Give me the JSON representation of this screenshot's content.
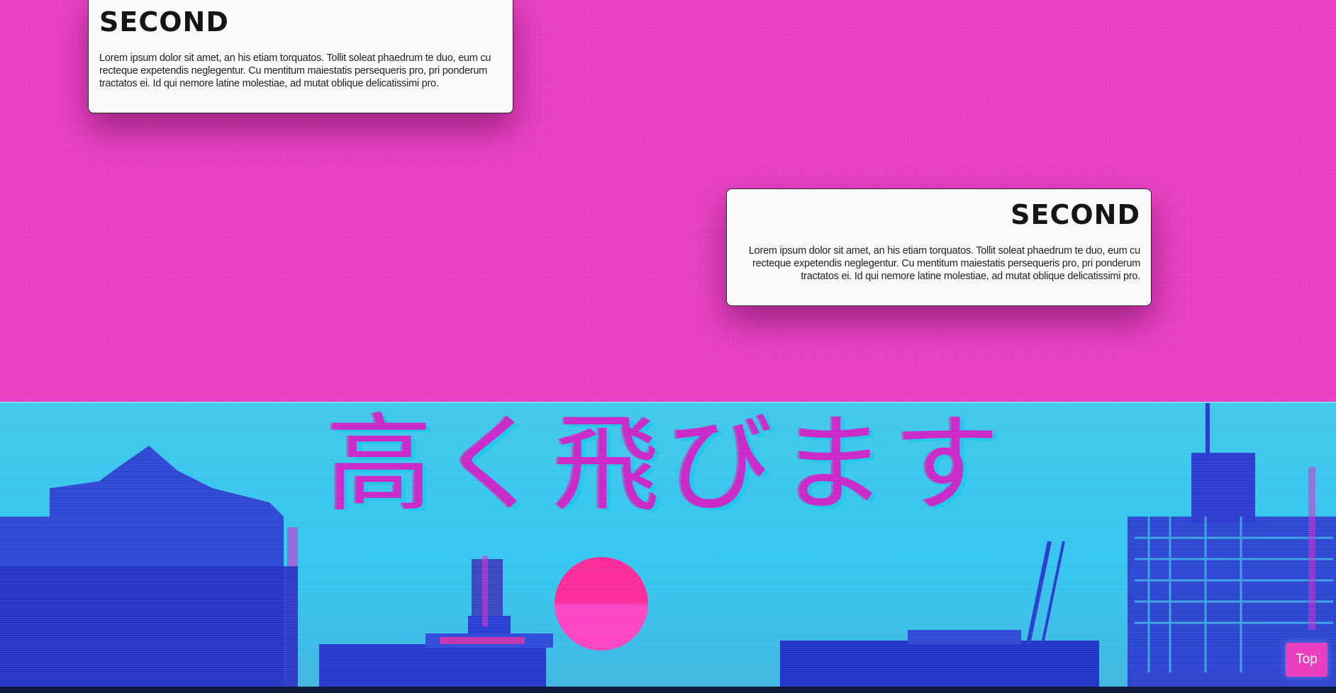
{
  "cards": [
    {
      "title": "SECOND",
      "text": "Lorem ipsum dolor sit amet, an his etiam torquatos. Tollit soleat phaedrum te duo, eum cu recteque expetendis neglegentur. Cu mentitum maiestatis persequeris pro, pri ponderum tractatos ei. Id qui nemore latine molestiae, ad mutat oblique delicatissimi pro."
    },
    {
      "title": "SECOND",
      "text": "Lorem ipsum dolor sit amet, an his etiam torquatos. Tollit soleat phaedrum te duo, eum cu recteque expetendis neglegentur. Cu mentitum maiestatis persequeris pro, pri ponderum tractatos ei. Id qui nemore latine molestiae, ad mutat oblique delicatissimi pro."
    }
  ],
  "banner": {
    "text": "高く飛びます"
  },
  "top_button": {
    "label": "Top"
  },
  "colors": {
    "background": "#e941c4",
    "card": "#fafafa",
    "banner_sky": "#33c6f0",
    "banner_text": "#c826c9",
    "buildings": "#2b3fd0",
    "sun": "#ff2a9a",
    "button": "#ea3fbf"
  }
}
